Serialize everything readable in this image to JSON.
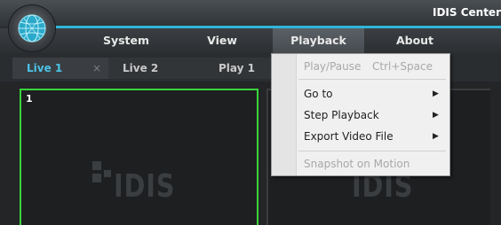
{
  "app": {
    "title": "IDIS Center"
  },
  "menubar": {
    "items": [
      {
        "label": "System"
      },
      {
        "label": "View"
      },
      {
        "label": "Playback"
      },
      {
        "label": "About"
      }
    ]
  },
  "tabs": [
    {
      "label": "Live 1",
      "active": true
    },
    {
      "label": "Live 2"
    },
    {
      "label": "Play 1"
    }
  ],
  "tab_close_glyph": "×",
  "panes": [
    {
      "number": "1",
      "watermark": "IDIS"
    },
    {
      "watermark": "IDIS"
    }
  ],
  "playback_menu": {
    "items": [
      {
        "label": "Play/Pause",
        "shortcut": "Ctrl+Space",
        "enabled": false
      },
      {
        "label": "Go to",
        "submenu": true,
        "enabled": true
      },
      {
        "label": "Step Playback",
        "submenu": true,
        "enabled": true
      },
      {
        "label": "Export Video File",
        "submenu": true,
        "enabled": true
      },
      {
        "label": "Snapshot on Motion",
        "enabled": false
      }
    ],
    "submenu_arrow": "▶"
  },
  "colors": {
    "accent": "#2fb6d8",
    "active_tab_text": "#4cc3e6",
    "selected_pane_border": "#3cd43c"
  }
}
